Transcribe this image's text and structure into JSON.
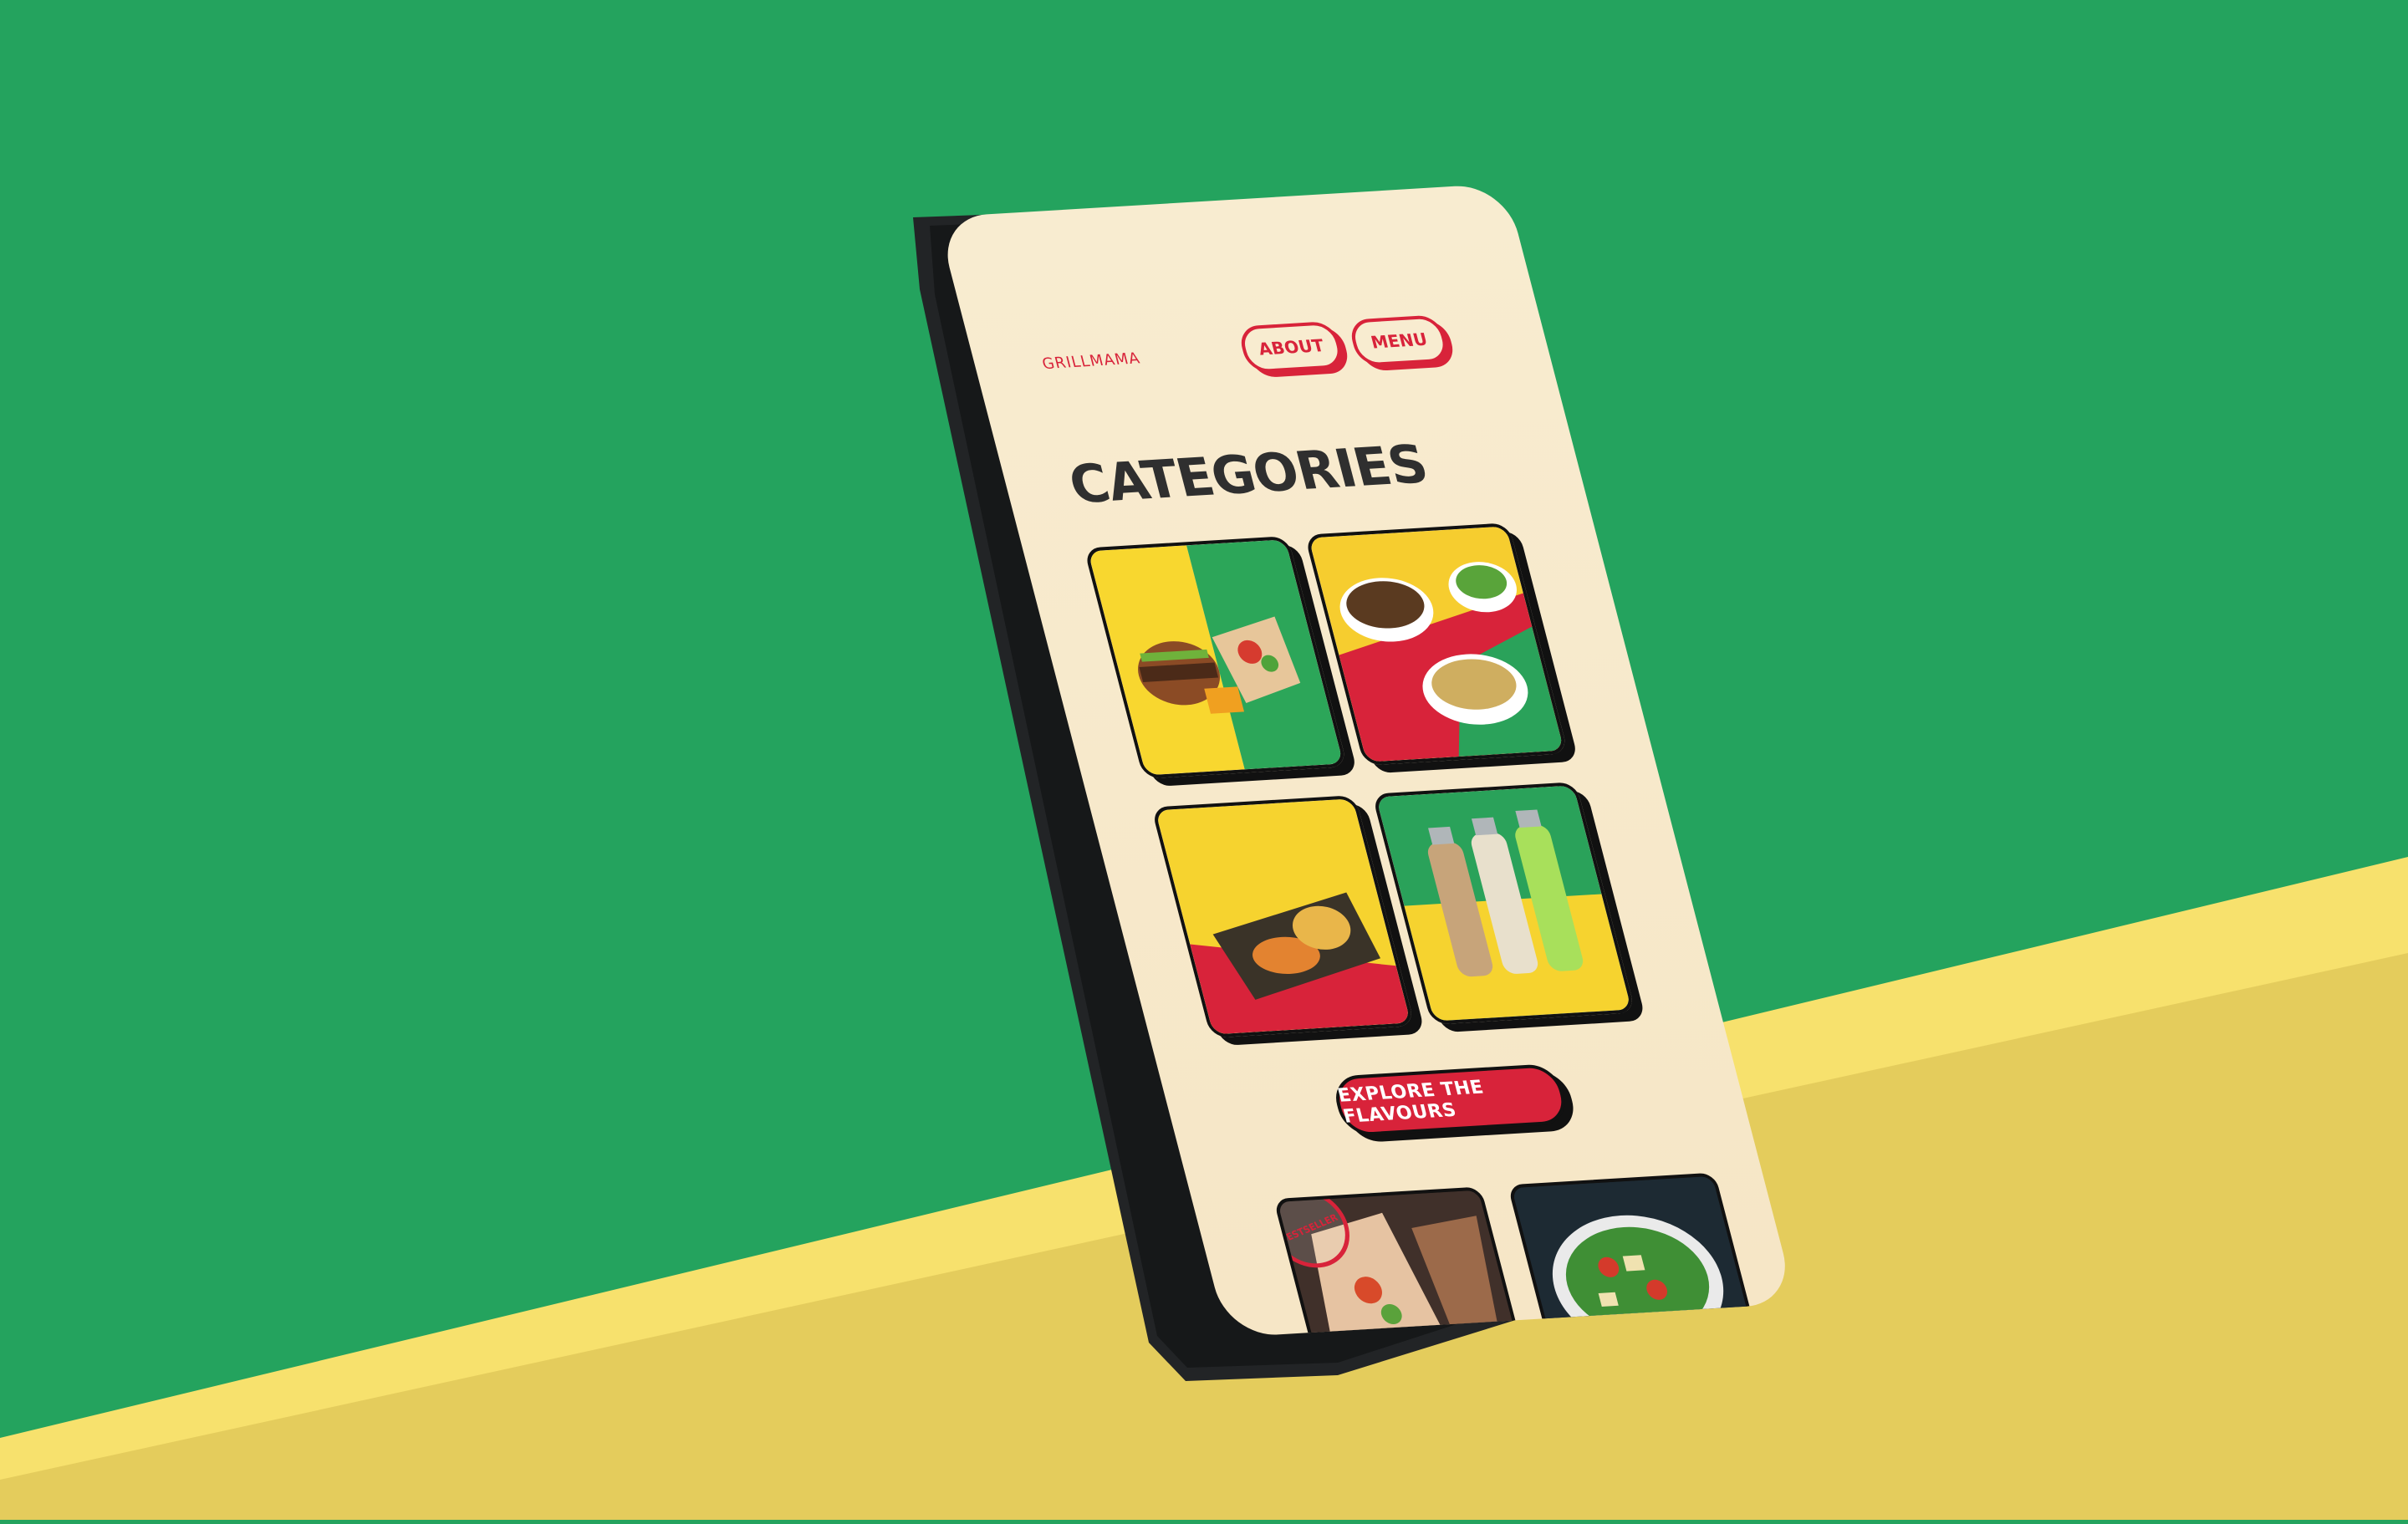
{
  "scene": {
    "background": "#24a35e",
    "floor_color": "#f7e16d",
    "floor_shadow": "#d6bb4e"
  },
  "app": {
    "brand": "GRILLMAMA",
    "nav": {
      "about": "ABOUT",
      "menu": "MENU"
    },
    "title": "CATEGORIES",
    "categories": [
      {
        "name": "burger-wrap-combo-icon"
      },
      {
        "name": "salad-bowls-icon"
      },
      {
        "name": "grilled-chicken-rice-icon"
      },
      {
        "name": "bottled-drinks-icon"
      }
    ],
    "cta": "EXPLORE THE FLAVOURS",
    "bestseller_badge": "BESTSELLER",
    "accent": "#d8233a",
    "cream": "#f8ecd0"
  }
}
